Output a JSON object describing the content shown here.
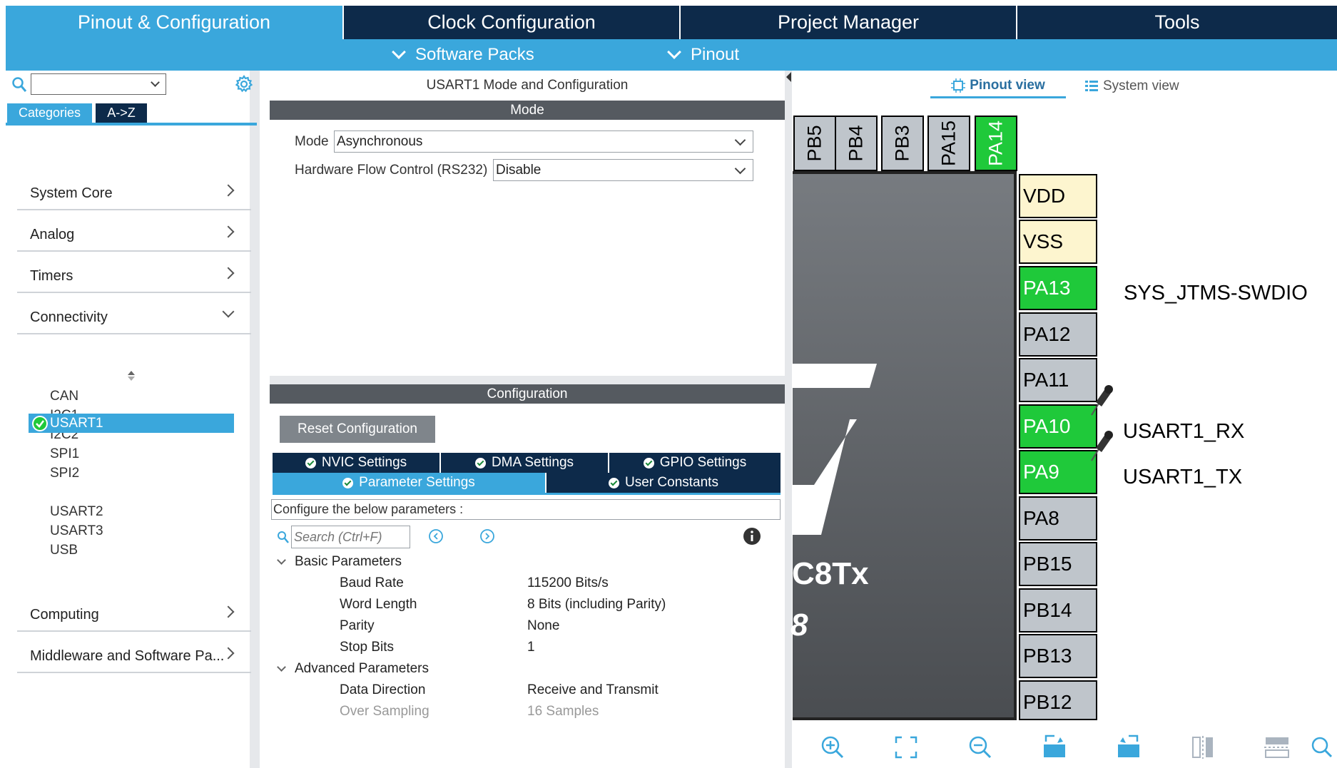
{
  "top_tabs": [
    {
      "label": "Pinout & Configuration"
    },
    {
      "label": "Clock Configuration"
    },
    {
      "label": "Project Manager"
    },
    {
      "label": "Tools"
    }
  ],
  "sub_menu": {
    "software_packs": "Software Packs",
    "pinout": "Pinout"
  },
  "left": {
    "search_value": "",
    "tab_categories": "Categories",
    "tab_az": "A->Z",
    "categories": [
      {
        "label": "System Core"
      },
      {
        "label": "Analog"
      },
      {
        "label": "Timers"
      },
      {
        "label": "Connectivity"
      }
    ],
    "peripherals": [
      "CAN",
      "I2C1",
      "I2C2",
      "SPI1",
      "SPI2",
      "USART1",
      "USART2",
      "USART3",
      "USB"
    ],
    "more_categories": [
      {
        "label": "Computing"
      },
      {
        "label": "Middleware and Software Pa..."
      }
    ]
  },
  "middle": {
    "title": "USART1 Mode and Configuration",
    "mode_header": "Mode",
    "mode_label": "Mode",
    "mode_value": "Asynchronous",
    "hwfc_label": "Hardware Flow Control (RS232)",
    "hwfc_value": "Disable",
    "config_header": "Configuration",
    "reset_button": "Reset Configuration",
    "tabs_row1": [
      "NVIC Settings",
      "DMA Settings",
      "GPIO Settings"
    ],
    "tabs_row2": [
      "Parameter Settings",
      "User Constants"
    ],
    "configure_text": "Configure the below parameters :",
    "search_placeholder": "Search (Ctrl+F)",
    "basic_group": "Basic Parameters",
    "basic_params": [
      {
        "name": "Baud Rate",
        "value": "115200 Bits/s"
      },
      {
        "name": "Word Length",
        "value": "8 Bits (including Parity)"
      },
      {
        "name": "Parity",
        "value": "None"
      },
      {
        "name": "Stop Bits",
        "value": "1"
      }
    ],
    "advanced_group": "Advanced Parameters",
    "advanced_params": [
      {
        "name": "Data Direction",
        "value": "Receive and Transmit"
      },
      {
        "name": "Over Sampling",
        "value": "16 Samples"
      }
    ]
  },
  "right": {
    "pinout_view": "Pinout view",
    "system_view": "System view",
    "top_pins": [
      "PB5",
      "PB4",
      "PB3",
      "PA15",
      "PA14"
    ],
    "side_pins": [
      "VDD",
      "VSS",
      "PA13",
      "PA12",
      "PA11",
      "PA10",
      "PA9",
      "PA8",
      "PB15",
      "PB14",
      "PB13",
      "PB12"
    ],
    "chip_text1": "C8Tx",
    "chip_text2": "8",
    "signals": {
      "pa13": "SYS_JTMS-SWDIO",
      "pa10": "USART1_RX",
      "pa9": "USART1_TX"
    }
  },
  "colors": {
    "accent": "#3aa7dc",
    "dark": "#0d2a4a",
    "pin_green": "#1fc93a",
    "pin_power": "#fdf5cf",
    "pin_grey": "#bfc5cb"
  }
}
